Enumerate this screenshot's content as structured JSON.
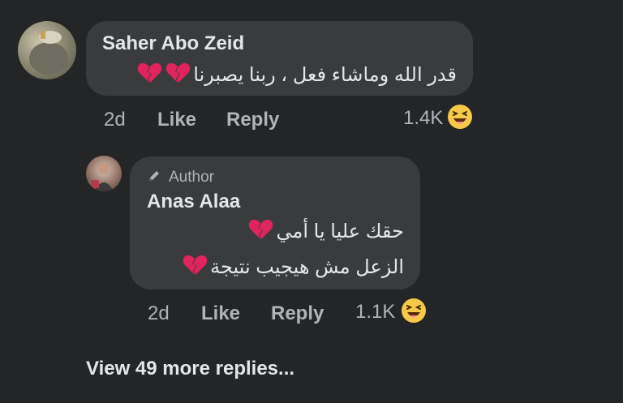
{
  "comment": {
    "author": "Saher Abo Zeid",
    "text": "قدر الله وماشاء فعل ، ربنا يصبرنا",
    "time": "2d",
    "like_label": "Like",
    "reply_label": "Reply",
    "reaction_count": "1.4K",
    "reaction_icon": "laughing-emoji",
    "broken_heart_count": 2
  },
  "reply": {
    "badge": "Author",
    "author": "Anas Alaa",
    "line1": "حقك عليا يا أمي",
    "line2": "الزعل مش هيجيب نتيجة",
    "time": "2d",
    "like_label": "Like",
    "reply_label": "Reply",
    "reaction_count": "1.1K",
    "reaction_icon": "laughing-emoji"
  },
  "view_more": "View 49 more replies...",
  "colors": {
    "background": "#242526",
    "bubble": "#3a3b3c",
    "primary_text": "#e4e6eb",
    "secondary_text": "#b0b3b8",
    "broken_heart": "#e0245e"
  }
}
